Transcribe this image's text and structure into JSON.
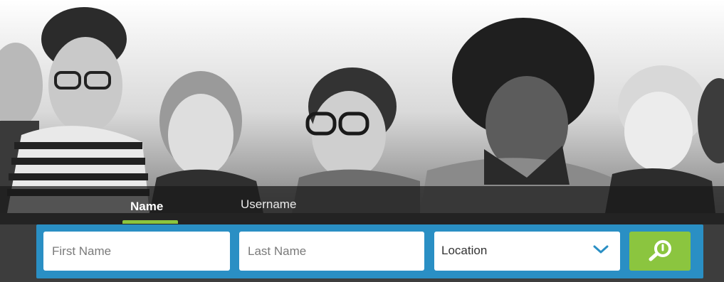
{
  "tabs": [
    {
      "label": "Name",
      "active": true
    },
    {
      "label": "Username",
      "active": false
    }
  ],
  "search": {
    "first_name_placeholder": "First Name",
    "last_name_placeholder": "Last Name",
    "location_label": "Location"
  },
  "colors": {
    "accent_green": "#8bc53f",
    "bar_blue": "#2a8fc4",
    "chevron_blue": "#2a8fc4"
  },
  "icons": {
    "search": "search-icon",
    "dropdown": "chevron-down-icon"
  }
}
